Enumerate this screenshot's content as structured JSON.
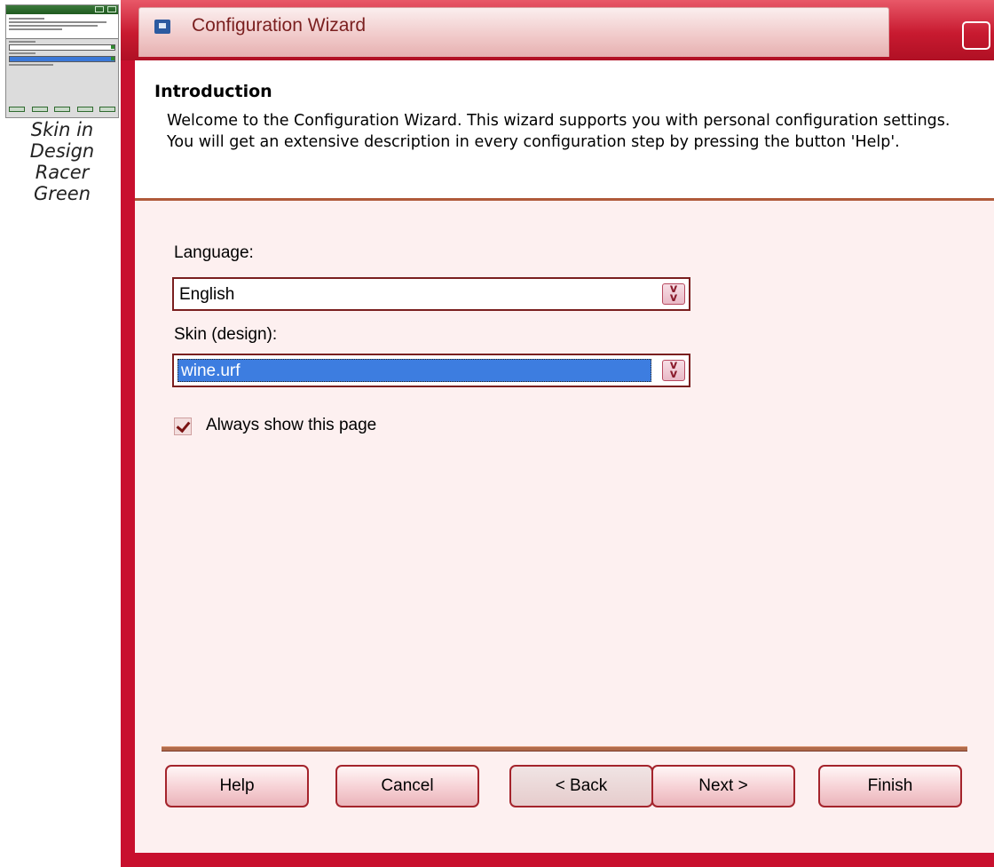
{
  "caption": {
    "lines": [
      "Skin in",
      "Design",
      "Racer",
      "Green"
    ]
  },
  "window": {
    "title": "Configuration Wizard"
  },
  "header": {
    "title": "Introduction",
    "description": "Welcome to the Configuration Wizard. This wizard supports you with personal configuration settings. You will get an extensive description in every configuration step by pressing the button 'Help'."
  },
  "form": {
    "language_label": "Language:",
    "language_value": "English",
    "skin_label": "Skin (design):",
    "skin_value": "wine.urf",
    "always_show_label": "Always show this page",
    "always_show_checked": true
  },
  "buttons": {
    "help": "Help",
    "cancel": "Cancel",
    "back": "< Back",
    "next": "Next >",
    "finish": "Finish"
  },
  "icons": {
    "app": "wizard-app-icon",
    "dropdown": "double-chevron-down-icon",
    "check": "checkmark-icon"
  },
  "colors": {
    "frame": "#c8102e",
    "client_background": "#fdf0f0",
    "selection": "#3d7de0"
  }
}
